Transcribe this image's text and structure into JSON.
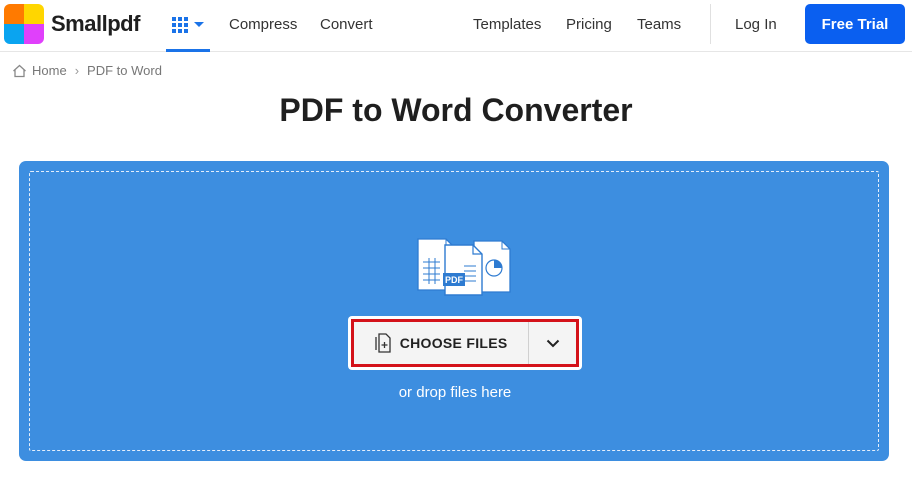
{
  "header": {
    "brand": "Smallpdf",
    "nav_left": [
      "Compress",
      "Convert"
    ],
    "nav_right": [
      "Templates",
      "Pricing",
      "Teams"
    ],
    "login": "Log In",
    "cta": "Free Trial"
  },
  "breadcrumb": {
    "home": "Home",
    "separator": "›",
    "current": "PDF to Word"
  },
  "page": {
    "title": "PDF to Word Converter"
  },
  "upload": {
    "choose_label": "CHOOSE FILES",
    "drop_hint": "or drop files here",
    "illustration_badge": "PDF"
  },
  "colors": {
    "brand_blue": "#0a5ff0",
    "panel_blue": "#3d8ee0",
    "highlight_red": "#d4121a"
  },
  "icons": [
    "apps-grid-icon",
    "chevron-down-icon",
    "home-icon",
    "file-add-icon",
    "file-stack-icon"
  ]
}
